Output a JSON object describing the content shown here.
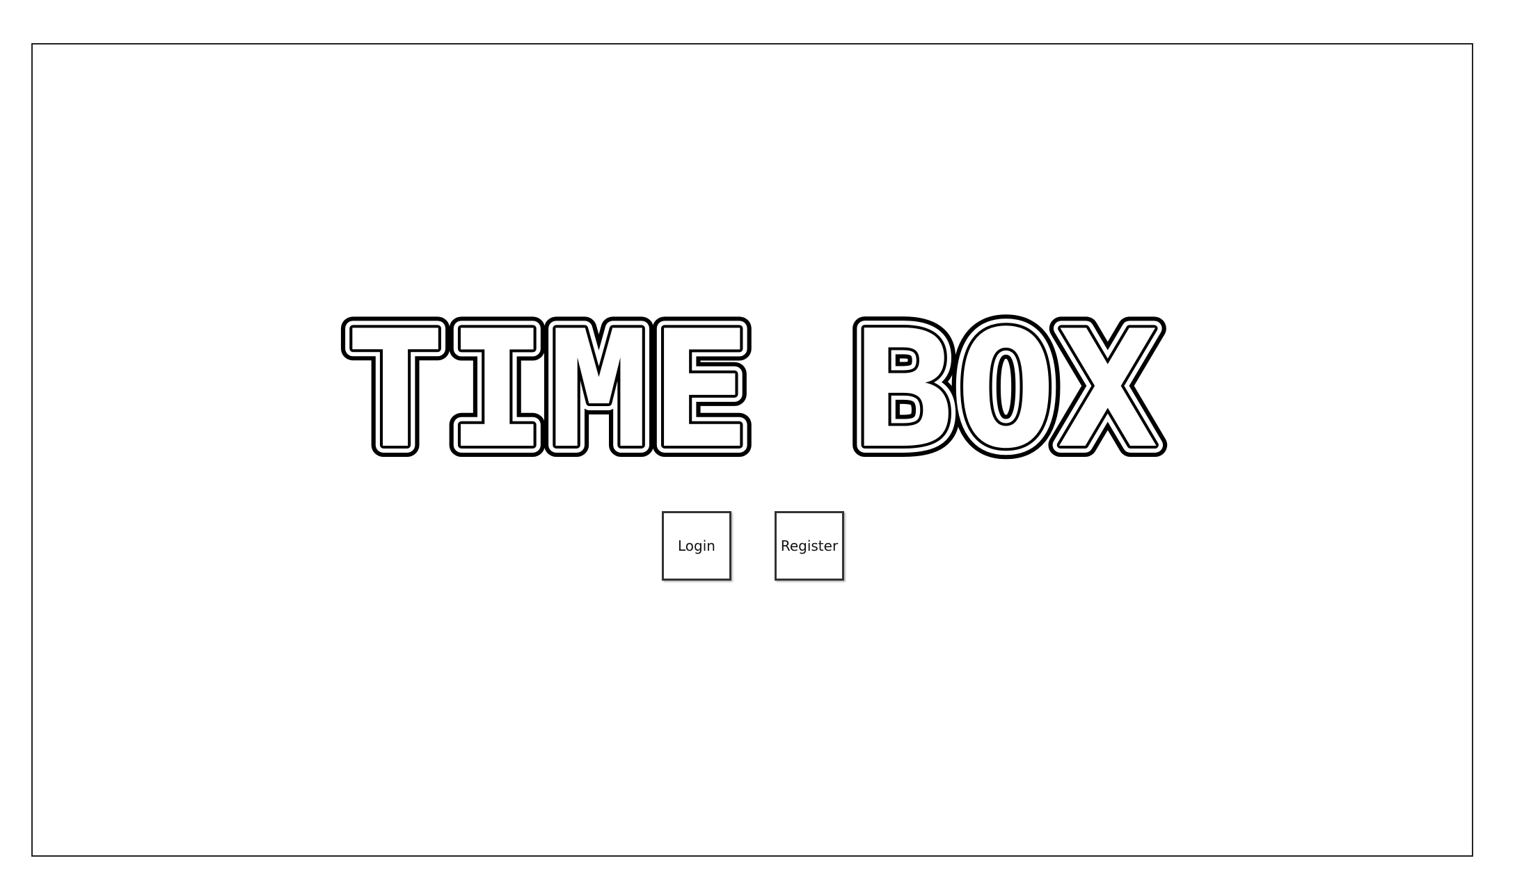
{
  "app": {
    "title": "TIME BOX"
  },
  "actions": {
    "login_label": "Login",
    "register_label": "Register"
  },
  "colors": {
    "background": "#ffffff",
    "frame_border": "#222222",
    "logo_outline": "#000000",
    "button_border": "#333333"
  }
}
